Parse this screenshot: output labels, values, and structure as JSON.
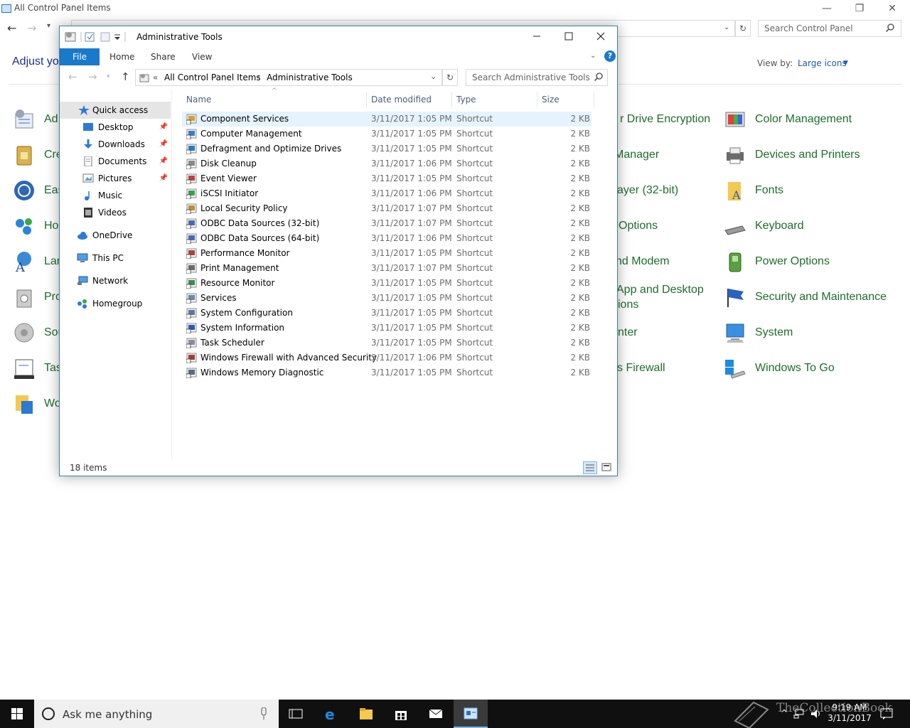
{
  "background": {
    "title": "All Control Panel Items",
    "window_controls": [
      "—",
      "❐",
      "✕"
    ],
    "search_placeholder": "Search Control Panel",
    "adjust_text": "Adjust yo",
    "view_by_label": "View by:",
    "view_by_value": "Large icons",
    "left_items": [
      "Adı",
      "Cre",
      "Eas",
      "Ho",
      "Lar",
      "Pro",
      "Sou",
      "Tas",
      "Wo"
    ],
    "mid_items": [
      "r Drive Encryption",
      "Manager",
      "ayer (32-bit)",
      "Options",
      "nd Modem",
      "App and Desktop",
      "ions",
      "nter",
      "s Firewall"
    ],
    "right_items": [
      "Color Management",
      "Devices and Printers",
      "Fonts",
      "Keyboard",
      "Power Options",
      "Security and Maintenance",
      "System",
      "Windows To Go"
    ]
  },
  "window": {
    "title": "Administrative Tools",
    "ribbon": {
      "file": "File",
      "home": "Home",
      "share": "Share",
      "view": "View",
      "help": "?"
    },
    "address": {
      "sep": "«",
      "crumb1": "All Control Panel Items",
      "crumb2": "Administrative Tools"
    },
    "search_placeholder": "Search Administrative Tools",
    "nav": [
      {
        "label": "Quick access",
        "icon": "star-icon"
      },
      {
        "label": "Desktop",
        "icon": "desktop-icon"
      },
      {
        "label": "Downloads",
        "icon": "download-icon"
      },
      {
        "label": "Documents",
        "icon": "document-icon"
      },
      {
        "label": "Pictures",
        "icon": "picture-icon"
      },
      {
        "label": "Music",
        "icon": "music-icon"
      },
      {
        "label": "Videos",
        "icon": "video-icon"
      },
      {
        "label": "OneDrive",
        "icon": "cloud-icon"
      },
      {
        "label": "This PC",
        "icon": "computer-icon"
      },
      {
        "label": "Network",
        "icon": "network-icon"
      },
      {
        "label": "Homegroup",
        "icon": "homegroup-icon"
      }
    ],
    "columns": {
      "name": "Name",
      "date": "Date modified",
      "type": "Type",
      "size": "Size"
    },
    "files": [
      {
        "name": "Component Services",
        "date": "3/11/2017 1:05 PM",
        "type": "Shortcut",
        "size": "2 KB"
      },
      {
        "name": "Computer Management",
        "date": "3/11/2017 1:05 PM",
        "type": "Shortcut",
        "size": "2 KB"
      },
      {
        "name": "Defragment and Optimize Drives",
        "date": "3/11/2017 1:05 PM",
        "type": "Shortcut",
        "size": "2 KB"
      },
      {
        "name": "Disk Cleanup",
        "date": "3/11/2017 1:06 PM",
        "type": "Shortcut",
        "size": "2 KB"
      },
      {
        "name": "Event Viewer",
        "date": "3/11/2017 1:05 PM",
        "type": "Shortcut",
        "size": "2 KB"
      },
      {
        "name": "iSCSI Initiator",
        "date": "3/11/2017 1:06 PM",
        "type": "Shortcut",
        "size": "2 KB"
      },
      {
        "name": "Local Security Policy",
        "date": "3/11/2017 1:07 PM",
        "type": "Shortcut",
        "size": "2 KB"
      },
      {
        "name": "ODBC Data Sources (32-bit)",
        "date": "3/11/2017 1:07 PM",
        "type": "Shortcut",
        "size": "2 KB"
      },
      {
        "name": "ODBC Data Sources (64-bit)",
        "date": "3/11/2017 1:06 PM",
        "type": "Shortcut",
        "size": "2 KB"
      },
      {
        "name": "Performance Monitor",
        "date": "3/11/2017 1:05 PM",
        "type": "Shortcut",
        "size": "2 KB"
      },
      {
        "name": "Print Management",
        "date": "3/11/2017 1:07 PM",
        "type": "Shortcut",
        "size": "2 KB"
      },
      {
        "name": "Resource Monitor",
        "date": "3/11/2017 1:05 PM",
        "type": "Shortcut",
        "size": "2 KB"
      },
      {
        "name": "Services",
        "date": "3/11/2017 1:05 PM",
        "type": "Shortcut",
        "size": "2 KB"
      },
      {
        "name": "System Configuration",
        "date": "3/11/2017 1:05 PM",
        "type": "Shortcut",
        "size": "2 KB"
      },
      {
        "name": "System Information",
        "date": "3/11/2017 1:05 PM",
        "type": "Shortcut",
        "size": "2 KB"
      },
      {
        "name": "Task Scheduler",
        "date": "3/11/2017 1:05 PM",
        "type": "Shortcut",
        "size": "2 KB"
      },
      {
        "name": "Windows Firewall with Advanced Security",
        "date": "3/11/2017 1:06 PM",
        "type": "Shortcut",
        "size": "2 KB"
      },
      {
        "name": "Windows Memory Diagnostic",
        "date": "3/11/2017 1:05 PM",
        "type": "Shortcut",
        "size": "2 KB"
      }
    ],
    "status": "18 items"
  },
  "taskbar": {
    "cortana_placeholder": "Ask me anything",
    "time": "9:19 AM",
    "date": "3/11/2017",
    "watermark": "TheCollectionBook"
  },
  "colors": {
    "accent": "#1979ca",
    "cp_link": "#1e6e2a",
    "selection": "#e5f3ff"
  }
}
